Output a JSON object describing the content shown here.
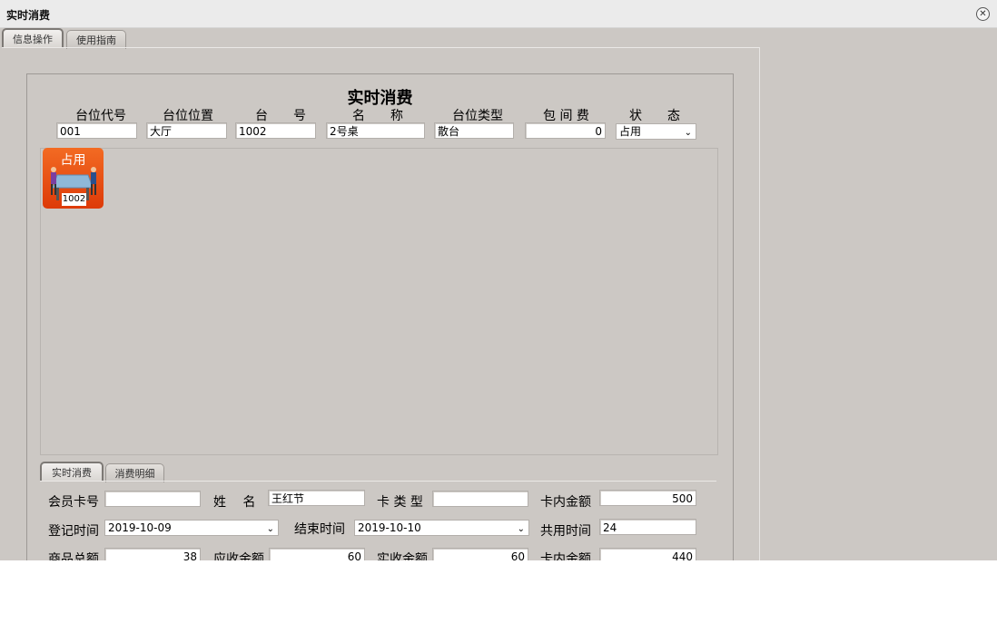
{
  "window": {
    "title": "实时消费",
    "close_icon": "close-icon"
  },
  "tabs": [
    "信息操作",
    "使用指南"
  ],
  "heading": "实时消费",
  "table_header": {
    "labels": [
      "台位代号",
      "台位位置",
      "台　　号",
      "名　　称",
      "台位类型",
      "包 间 费",
      "状　　态"
    ],
    "values": {
      "code": "001",
      "location": "大厅",
      "number": "1002",
      "name": "2号桌",
      "type": "散台",
      "room_fee": "0",
      "status": "占用"
    }
  },
  "tile": {
    "status": "占用",
    "number": "1002",
    "icon": "table-occupied-icon"
  },
  "sub_tabs": [
    "实时消费",
    "消费明细"
  ],
  "form": {
    "member_card": {
      "label": "会员卡号",
      "value": ""
    },
    "name": {
      "label": "姓　 名",
      "value": "王红节"
    },
    "card_type": {
      "label": "卡 类 型",
      "value": ""
    },
    "card_balance": {
      "label": "卡内金额",
      "value": "500"
    },
    "checkin_time": {
      "label": "登记时间",
      "value": "2019-10-09"
    },
    "end_time": {
      "label": "结束时间",
      "value": "2019-10-10"
    },
    "total_time": {
      "label": "共用时间",
      "value": "24"
    },
    "goods_total": {
      "label": "商品总额",
      "value": "38"
    },
    "receivable": {
      "label": "应收金额",
      "value": "60"
    },
    "received": {
      "label": "实收金额",
      "value": "60"
    },
    "card_remaining": {
      "label": "卡内金额",
      "value": "440"
    }
  }
}
